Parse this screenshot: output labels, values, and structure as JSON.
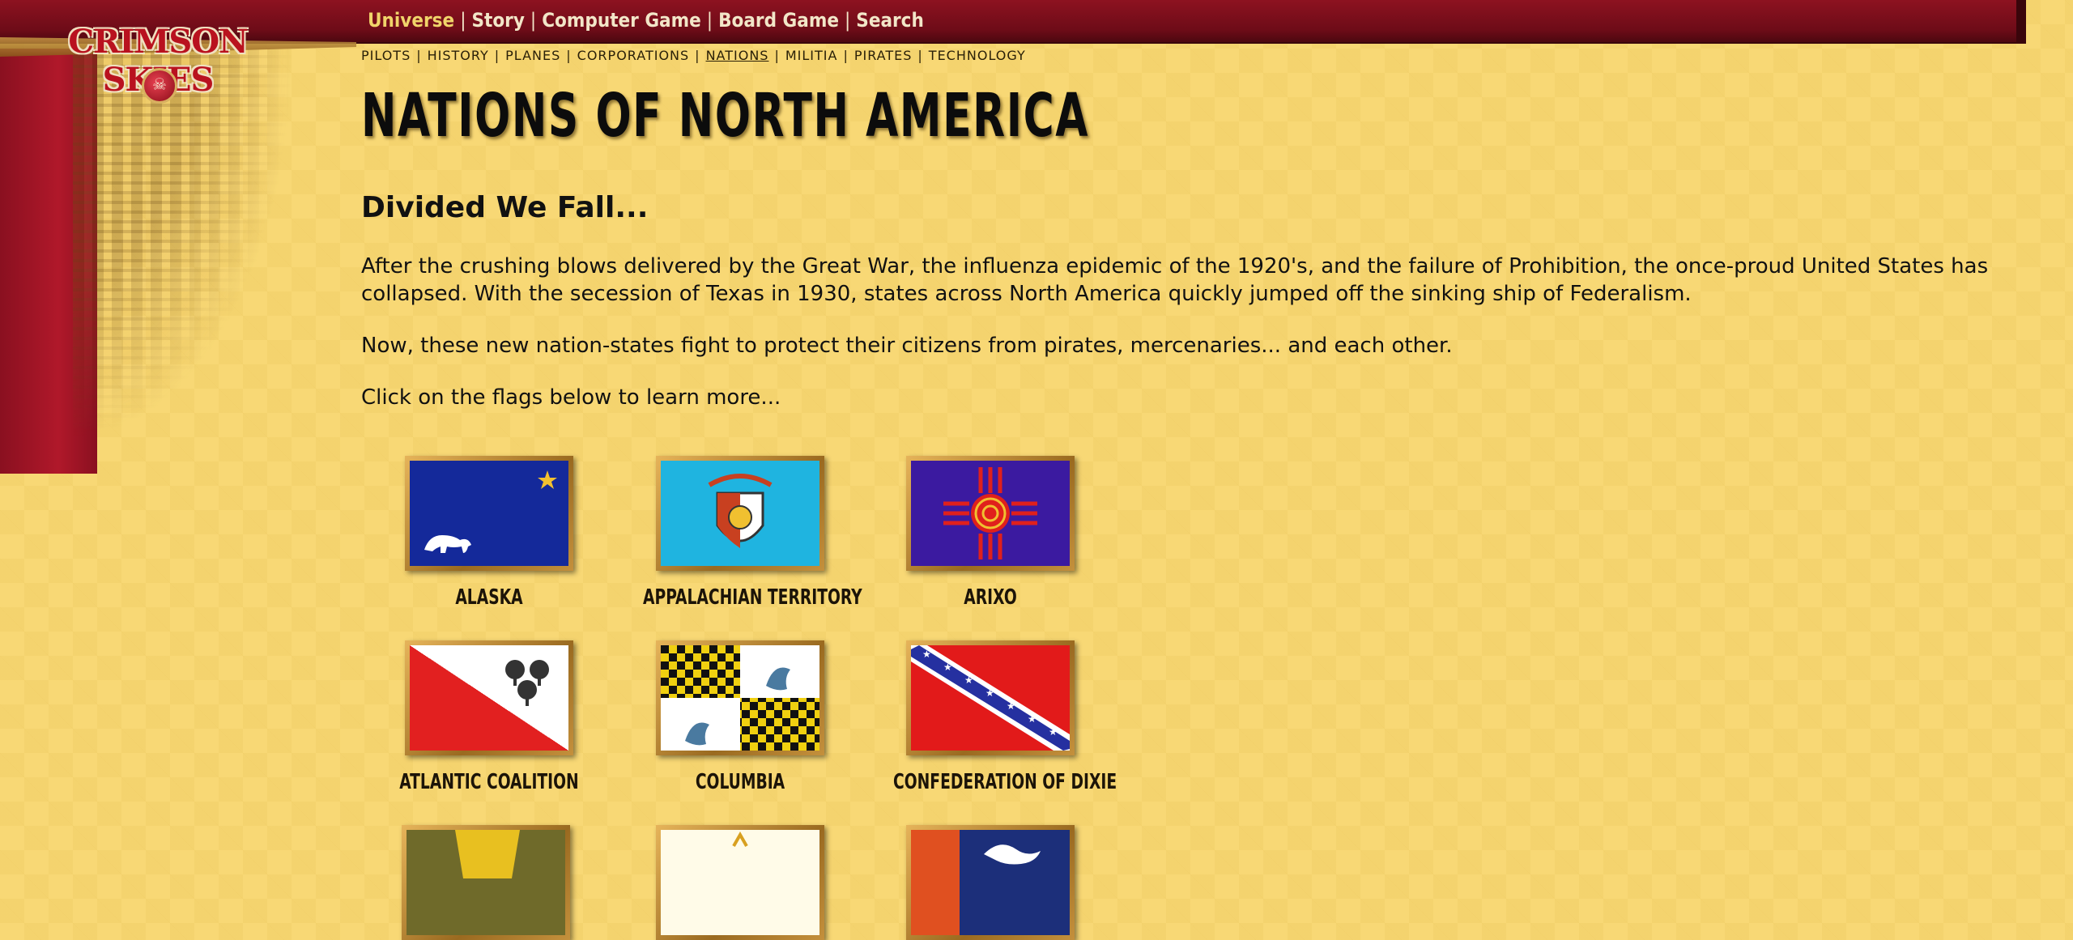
{
  "main_nav": {
    "items": [
      "Universe",
      "Story",
      "Computer Game",
      "Board Game",
      "Search"
    ],
    "active": "Universe"
  },
  "sub_nav": {
    "items": [
      "PILOTS",
      "HISTORY",
      "PLANES",
      "CORPORATIONS",
      "NATIONS",
      "MILITIA",
      "PIRATES",
      "TECHNOLOGY"
    ],
    "active": "NATIONS"
  },
  "logo": {
    "text": "CRIMSON SKIES"
  },
  "page": {
    "title": "NATIONS OF NORTH AMERICA",
    "heading": "Divided We Fall...",
    "paragraphs": [
      "After the crushing blows delivered by the Great War, the influenza epidemic of the 1920's, and the failure of Prohibition, the once-proud United States has collapsed. With the secession of Texas in 1930, states across North America quickly jumped off the sinking ship of Federalism.",
      "Now, these new nation-states fight to protect their citizens from pirates, mercenaries... and each other.",
      "Click on the flags below to learn more..."
    ]
  },
  "flags": [
    {
      "label": "ALASKA",
      "colors": [
        "#14299a",
        "#f2c030",
        "#ffffff"
      ]
    },
    {
      "label": "APPALACHIAN TERRITORY",
      "colors": [
        "#1fb4e0",
        "#c84020",
        "#ffffff"
      ]
    },
    {
      "label": "ARIXO",
      "colors": [
        "#3b1aa0",
        "#e0201c",
        "#f0c030"
      ]
    },
    {
      "label": "ATLANTIC COALITION",
      "colors": [
        "#e22020",
        "#ffffff",
        "#333333"
      ]
    },
    {
      "label": "COLUMBIA",
      "colors": [
        "#111111",
        "#f0d010",
        "#ffffff"
      ]
    },
    {
      "label": "CONFEDERATION OF DIXIE",
      "colors": [
        "#e21a1a",
        "#2530a0",
        "#ffffff"
      ]
    }
  ],
  "colors": {
    "banner_red": "#8d1220",
    "background": "#f8d875",
    "frame_gold": "#c4903c"
  }
}
